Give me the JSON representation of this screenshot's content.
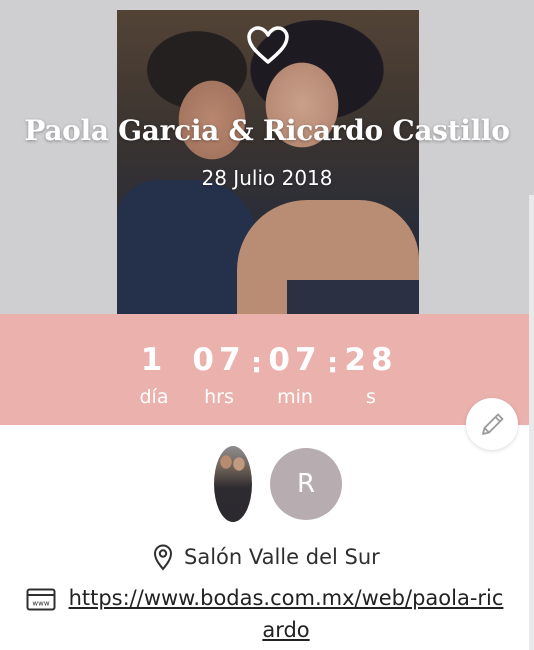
{
  "header": {
    "title": "Paola Garcia & Ricardo Castillo",
    "date": "28 Julio 2018"
  },
  "countdown": {
    "days": {
      "value": "1",
      "label": "día"
    },
    "hours": {
      "value": "07",
      "label": "hrs"
    },
    "minutes": {
      "value": "07",
      "label": "min"
    },
    "seconds": {
      "value": "28",
      "label": "s"
    },
    "separator": ":"
  },
  "avatars": {
    "initial": "R"
  },
  "venue": {
    "name": "Salón Valle del Sur",
    "icon": "location-pin-icon"
  },
  "website": {
    "url": "https://www.bodas.com.mx/web/paola-ricardo",
    "icon": "browser-window-icon"
  },
  "colors": {
    "countdown_band": "#ebb2ad",
    "avatar_r": "#b7adb0",
    "hero_bg": "#cfcfd1"
  }
}
